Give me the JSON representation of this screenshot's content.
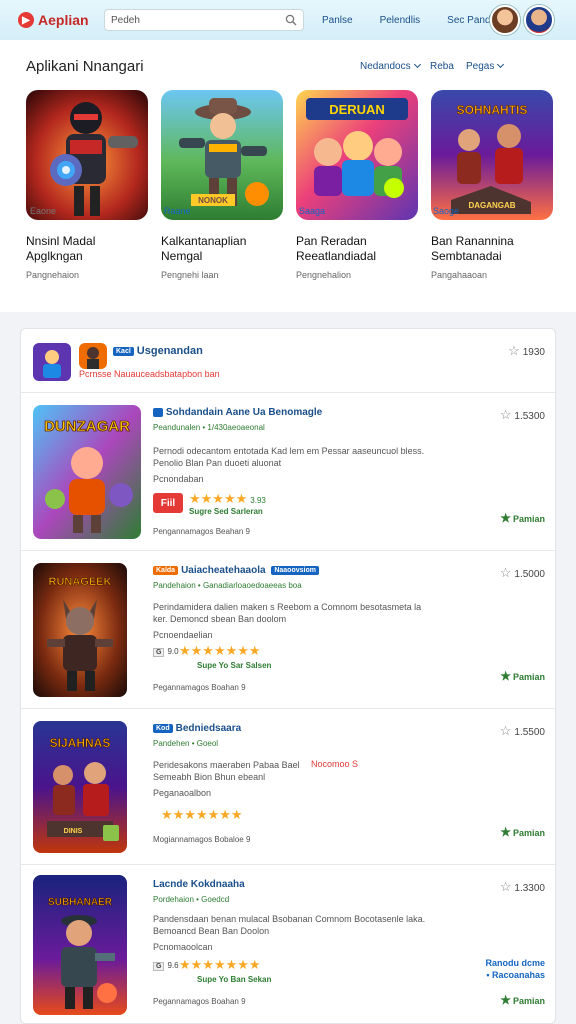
{
  "header": {
    "logo_text": "Aeplian",
    "search_placeholder": "Pedeh",
    "nav": [
      "Panlse",
      "Pelendlis",
      "Sec Pandds"
    ]
  },
  "featured": {
    "title": "Aplikani Nnangari",
    "controls": [
      "Nedandocs",
      "Reba",
      "Pegas"
    ],
    "cards": [
      {
        "name": "Nnsinl Madal Apglkngan",
        "sub": "Pangnehaion",
        "link": "Eaone",
        "link_color": "#777777"
      },
      {
        "name": "Kalkantanaplian Nemgal",
        "sub": "Pengnehi laan",
        "link": "Raane",
        "link_color": "#1565c0"
      },
      {
        "name": "Pan Reradan Reeatlandiadal",
        "sub": "Pengnehalion",
        "link": "Saaga",
        "link_color": "#1565c0"
      },
      {
        "name": "Ban Ranannina Sembtanadai",
        "sub": "Pangahaaoan",
        "link": "Saoge",
        "link_color": "#1565c0"
      }
    ],
    "card_art": [
      "ninja-robot",
      "cowboy-hero",
      "brawl-squad",
      "dino-warriors"
    ],
    "card_banners": [
      "",
      "NONOK",
      "DERUAN",
      "SOHNAHTIS"
    ]
  },
  "summary": {
    "tag": "Kacl",
    "title": "Usgenandan",
    "subtitle": "Pcrnsse Nauauceadsbatapbon ban",
    "rating_count": "1930"
  },
  "items": [
    {
      "thumb_title": "DUNZAGAR",
      "tag": "",
      "title": "Sohdandain Aane Ua Benomagle",
      "meta": "Peandunalen  •  1/430aeoaeonal",
      "desc": "Pernodi odecantom entotada Kad lem em Pessar aaseuncuol bless. Penolio Blan Pan duoeti aluonat",
      "desc2": "Pcnondaban",
      "stars": "★★★★★",
      "stars_val": "3.93",
      "sales": "Sugre Sed Sarleran",
      "badge": "Fiil",
      "foot": "Pengannamagos Beahan",
      "rating_count": "1.5300",
      "price": "Pamian"
    },
    {
      "thumb_title": "RUNAGEEK",
      "tag": "Kalda",
      "tag2": "Naaoovsiom",
      "title": "Uaiacheatehaaola",
      "meta": "Pandehaion  •  Ganadiarloaoedoaeeas boa",
      "desc": "Perindamidera dalien maken s Reebom a Comnom besotasmeta la ker. Demoncd sbean Ban doolom",
      "desc2": "Pcnoendaelian",
      "score": "9.0",
      "stars": "★★★★★★★",
      "sales": "Supe Yo Sar Salsen",
      "foot": "Pegannamagos Boahan",
      "rating_count": "1.5000",
      "price": "Pamian"
    },
    {
      "thumb_title": "SIJAHNAS",
      "tag": "Kod",
      "title": "Bedniedsaara",
      "meta": "Pandehen  •  Goeol",
      "desc": "Peridesakons maeraben Pabaa Bael Semeabh Bion Bhun ebeanl",
      "desc_extra": "Nocomoo S",
      "desc2": "Peganaoalbon",
      "stars": "★★★★★★★",
      "foot": "Mogiannamagos Bobaloe",
      "rating_count": "1.5500",
      "price": "Pamian"
    },
    {
      "thumb_title": "SUBHANAER",
      "tag": "",
      "title": "Lacnde Kokdnaaha",
      "meta": "Pordehaion  •  Goedcd",
      "desc": "Pandensdaan benan mulacal Bsobanan Comnom Bocotasenle laka. Bemoancd Bean Ban Doolon",
      "desc2": "Pcnomaoolcan",
      "score": "9.6",
      "stars": "★★★★★★★",
      "sales": "Supe Yo Ban Sekan",
      "side_note": "Ranodu dcme • Racoanahas",
      "foot": "Pegannamagos Boahan",
      "rating_count": "1.3300",
      "price": "Pamian"
    }
  ],
  "colors": {
    "accent": "#1a4f8a",
    "price_green": "#2e7d32",
    "brand_red": "#e53935",
    "star_yellow": "#f9a825"
  }
}
